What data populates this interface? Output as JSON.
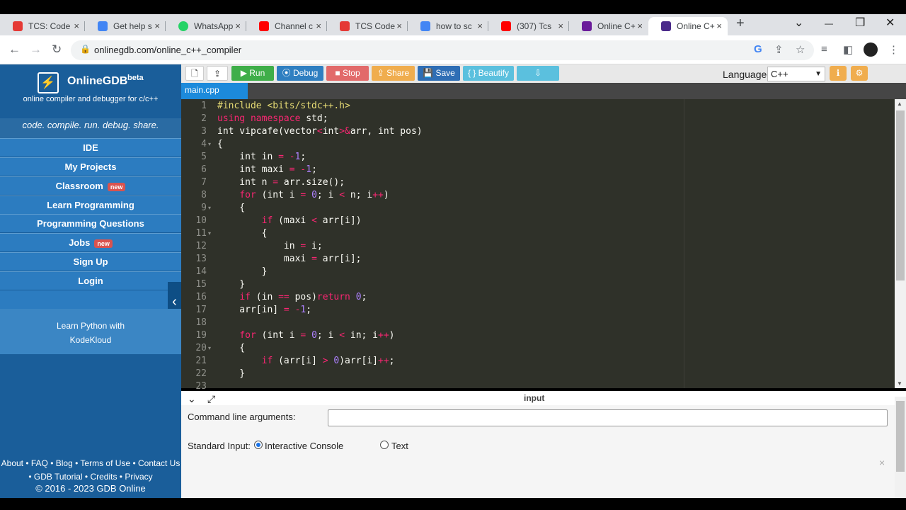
{
  "browser": {
    "tabs": [
      {
        "label": "TCS: Code",
        "color": "#e53935",
        "active": false
      },
      {
        "label": "Get help s",
        "color": "#4285f4",
        "active": false
      },
      {
        "label": "WhatsApp",
        "color": "#25d366",
        "active": false
      },
      {
        "label": "Channel c",
        "color": "#ff0000",
        "active": false
      },
      {
        "label": "TCS Code",
        "color": "#e53935",
        "active": false
      },
      {
        "label": "how to sc",
        "color": "#4285f4",
        "active": false
      },
      {
        "label": "(307) Tcs",
        "color": "#ff0000",
        "active": false
      },
      {
        "label": "Online C+",
        "color": "#6a1b9a",
        "active": false
      },
      {
        "label": "Online C+",
        "color": "#4a2a8a",
        "active": true
      }
    ],
    "tab_close": "×",
    "new_tab": "+",
    "url": "onlinegdb.com/online_c++_compiler",
    "window_controls": {
      "minimize": "—",
      "restore": "❐",
      "close": "✕",
      "dropdown": "⌄"
    }
  },
  "sidebar": {
    "logo_icon": "⚡",
    "title": "OnlineGDB",
    "beta": "beta",
    "subtitle": "online compiler and debugger for c/c++",
    "slogan": "code. compile. run. debug. share.",
    "nav": [
      {
        "label": "IDE",
        "badge": ""
      },
      {
        "label": "My Projects",
        "badge": ""
      },
      {
        "label": "Classroom",
        "badge": "new"
      },
      {
        "label": "Learn Programming",
        "badge": ""
      },
      {
        "label": "Programming Questions",
        "badge": ""
      },
      {
        "label": "Jobs",
        "badge": "new"
      },
      {
        "label": "Sign Up",
        "badge": ""
      },
      {
        "label": "Login",
        "badge": ""
      }
    ],
    "collapse_icon": "‹",
    "promo_line1": "Learn Python with",
    "promo_line2": "KodeKloud",
    "footer_line1": "About • FAQ • Blog • Terms of Use • Contact Us",
    "footer_line2": "• GDB Tutorial • Credits • Privacy",
    "copyright": "© 2016 - 2023 GDB Online"
  },
  "toolbar": {
    "new_file_icon": "🗋",
    "upload_icon": "⇪",
    "run": "▶ Run",
    "debug": "⦿ Debug",
    "stop": "■ Stop",
    "share": "⇪ Share",
    "save": "💾 Save",
    "beautify": "{ } Beautify",
    "download": "⇩",
    "colors": {
      "run": "#3fae49",
      "debug": "#2f7fc1",
      "stop": "#e26a6a",
      "share": "#f0ad4e",
      "save": "#2f6eb5",
      "beautify": "#5bc0de",
      "download": "#5bc0de"
    },
    "language_label": "Language",
    "language_value": "C++",
    "info_icon": "ℹ",
    "settings_icon": "⚙"
  },
  "editor": {
    "file_tab": "main.cpp",
    "line_numbers": [
      "1",
      "2",
      "3",
      "4",
      "5",
      "6",
      "7",
      "8",
      "9",
      "10",
      "11",
      "12",
      "13",
      "14",
      "15",
      "16",
      "17",
      "18",
      "19",
      "20",
      "21",
      "22",
      "23"
    ]
  },
  "io": {
    "title": "input",
    "collapse_icon": "⌄",
    "expand_icon": "⤢",
    "cmd_label": "Command line arguments:",
    "cmd_value": "",
    "stdin_label": "Standard Input:",
    "option_interactive": "Interactive Console",
    "option_text": "Text",
    "close_icon": "×"
  }
}
